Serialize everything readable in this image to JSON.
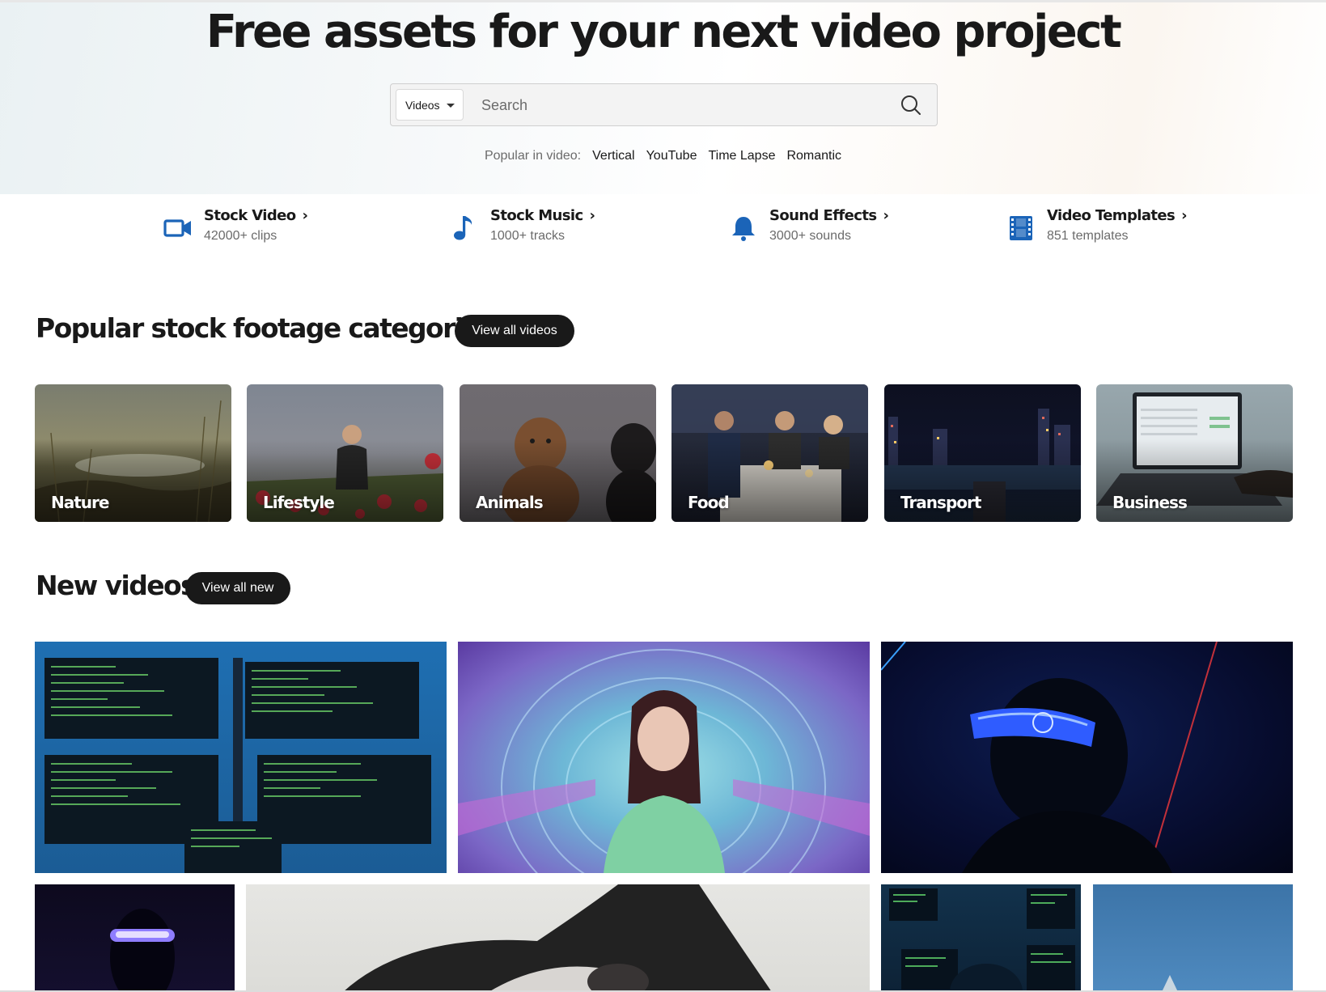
{
  "hero": {
    "title": "Free assets for your next video project"
  },
  "search": {
    "type_selected": "Videos",
    "placeholder": "Search"
  },
  "popular": {
    "label": "Popular in video:",
    "links": [
      "Vertical",
      "YouTube",
      "Time Lapse",
      "Romantic"
    ]
  },
  "asset_categories": [
    {
      "title": "Stock Video",
      "subtitle": "42000+ clips",
      "icon": "video-camera-icon"
    },
    {
      "title": "Stock Music",
      "subtitle": "1000+ tracks",
      "icon": "music-note-icon"
    },
    {
      "title": "Sound Effects",
      "subtitle": "3000+ sounds",
      "icon": "bell-icon"
    },
    {
      "title": "Video Templates",
      "subtitle": "851 templates",
      "icon": "film-strip-icon"
    }
  ],
  "popular_categories": {
    "title": "Popular stock footage categories",
    "button": "View all videos",
    "items": [
      "Nature",
      "Lifestyle",
      "Animals",
      "Food",
      "Transport",
      "Business"
    ]
  },
  "new_videos": {
    "title": "New videos",
    "button": "View all new"
  },
  "colors": {
    "accent_icon": "#1b64b8",
    "dark_button": "#191919"
  }
}
